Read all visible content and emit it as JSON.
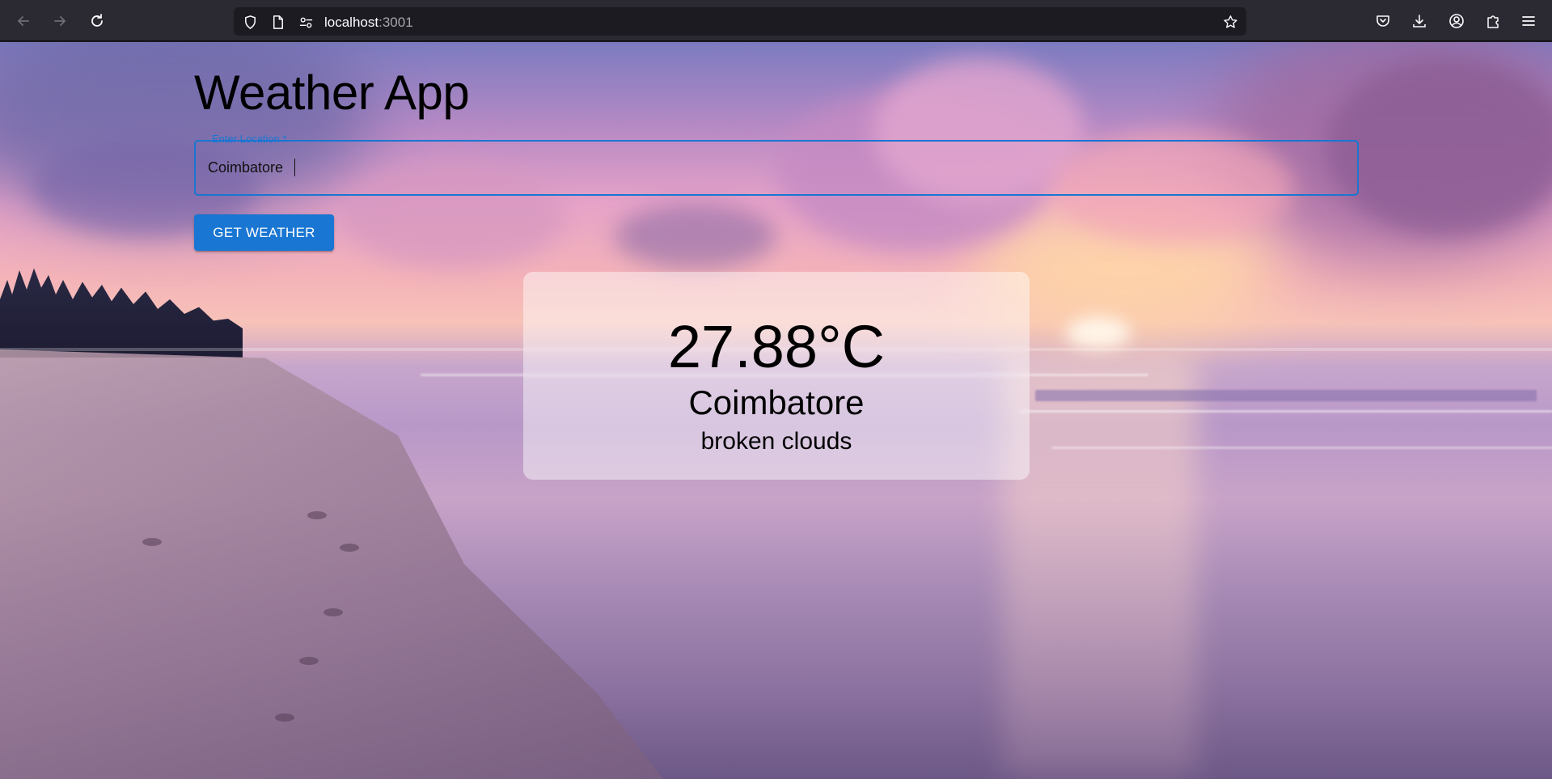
{
  "browser": {
    "url_host": "localhost",
    "url_port": ":3001",
    "icons": [
      "back-icon",
      "forward-icon",
      "reload-icon",
      "shield-icon",
      "page-icon",
      "permissions-icon",
      "star-icon",
      "pocket-icon",
      "download-icon",
      "account-icon",
      "extensions-icon",
      "menu-icon"
    ]
  },
  "app": {
    "title": "Weather App",
    "location_label": "Enter Location *",
    "location_value": "Coimbatore",
    "button_label": "GET WEATHER",
    "accent_color": "#1976d2"
  },
  "weather": {
    "temperature": "27.88°C",
    "city": "Coimbatore",
    "description": "broken clouds"
  }
}
